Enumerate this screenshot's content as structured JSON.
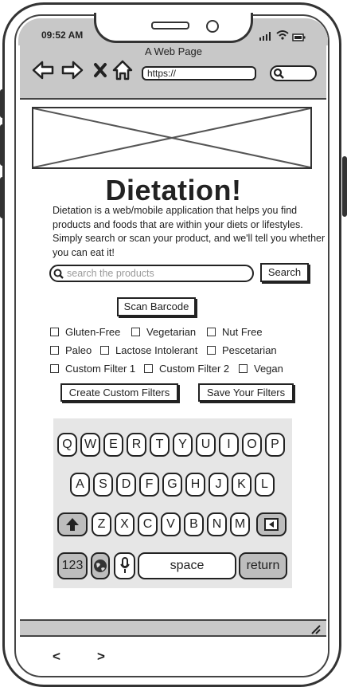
{
  "status_bar": {
    "time": "09:52 AM",
    "icons": [
      "signal-icon",
      "wifi-icon",
      "battery-icon"
    ]
  },
  "browser": {
    "page_title": "A Web Page",
    "url": "https://",
    "nav_icons": [
      "back-arrow-icon",
      "forward-arrow-icon",
      "close-icon",
      "home-icon",
      "search-icon"
    ]
  },
  "main": {
    "title": "Dietation!",
    "description": "Dietation is a web/mobile application that helps you find products and foods that are within your diets or lifestyles. Simply search or scan your product, and we'll tell you whether you can eat it!",
    "search": {
      "placeholder": "search the products",
      "button_label": "Search"
    },
    "scan_barcode_label": "Scan Barcode",
    "filters": {
      "row1": [
        "Gluten-Free",
        "Vegetarian",
        "Nut Free"
      ],
      "row2": [
        "Paleo",
        "Lactose Intolerant",
        "Pescetarian"
      ],
      "row3": [
        "Custom Filter 1",
        "Custom Filter 2",
        "Vegan"
      ]
    },
    "create_custom_filters_label": "Create Custom Filters",
    "save_filters_label": "Save Your Filters"
  },
  "keyboard": {
    "row1": [
      "Q",
      "W",
      "E",
      "R",
      "T",
      "Y",
      "U",
      "I",
      "O",
      "P"
    ],
    "row2": [
      "A",
      "S",
      "D",
      "F",
      "G",
      "H",
      "J",
      "K",
      "L"
    ],
    "row3": [
      "Z",
      "X",
      "C",
      "V",
      "B",
      "N",
      "M"
    ],
    "numbers_label": "123",
    "space_label": "space",
    "return_label": "return"
  },
  "bottom_nav": {
    "back": "<",
    "forward": ">"
  }
}
